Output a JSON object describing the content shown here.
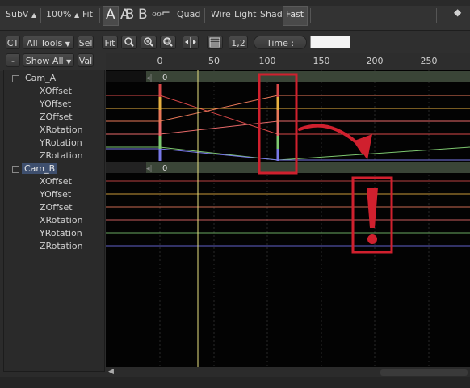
{
  "toolbar": {
    "subv_label": "SubV",
    "zoom_label": "100%",
    "fit_label": "Fit",
    "a_label": "A",
    "b_label": "B",
    "quad_label": "Quad",
    "wire_label": "Wire",
    "light_label": "Light",
    "shad_label": "Shad",
    "fast_label": "Fast"
  },
  "toolbar2": {
    "ct_label": "CT",
    "all_tools_label": "All Tools",
    "sel_label": "Sel",
    "fit_label": "Fit",
    "num_label": "1,2",
    "time_label": "Time :",
    "time_value": "",
    "minus_label": "-",
    "show_all_label": "Show All",
    "val_label": "Val"
  },
  "ruler": {
    "ticks": [
      "0",
      "50",
      "100",
      "150",
      "200",
      "250"
    ]
  },
  "tree": {
    "cam_a": "Cam_A",
    "cam_b": "Cam_B",
    "channels": [
      "XOffset",
      "YOffset",
      "ZOffset",
      "XRotation",
      "YRotation",
      "ZRotation"
    ]
  },
  "graph": {
    "row_value": "0",
    "current_frame": 37,
    "key_frames": [
      0,
      110
    ]
  },
  "annotation": {
    "colors": {
      "accent": "#d0202e"
    }
  },
  "colors": {
    "xoffset": "#d84848",
    "yoffset": "#e8b040",
    "zoffset": "#e87858",
    "xrotation": "#e86a6a",
    "yrotation": "#7ec870",
    "zrotation": "#7878e8",
    "time_cursor": "#e8e080"
  }
}
